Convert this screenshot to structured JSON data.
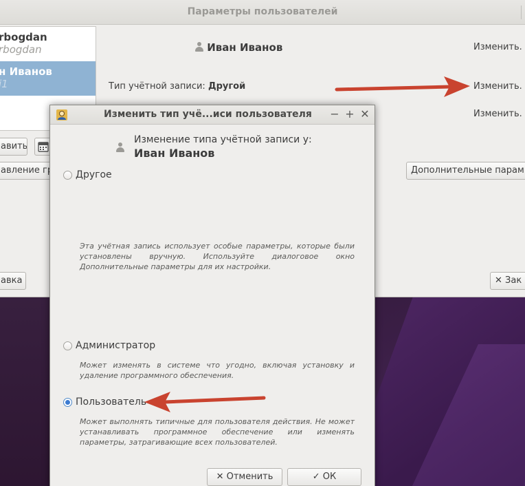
{
  "main_window": {
    "title": "Параметры пользователей",
    "users": [
      {
        "name": "rbogdan",
        "sub": "rbogdan"
      },
      {
        "name": "н Иванов",
        "sub": "i1"
      }
    ],
    "full_name": "Иван Иванов",
    "account_type_label": "Тип учётной записи:",
    "account_type_value": "Другой",
    "change_links": [
      "Изменить.",
      "Изменить.",
      "Изменить."
    ],
    "add_button": "авить",
    "manage_groups_button": "авление гр",
    "additional_params_button": "Дополнительные парам",
    "help_button": "авка",
    "close_button": "Зак"
  },
  "dialog": {
    "title": "Изменить тип учё...иси пользователя",
    "heading": "Изменение типа учётной записи у:",
    "user_name": "Иван Иванов",
    "options": [
      {
        "label": "Другое",
        "description": "Эта учётная запись использует особые параметры, которые были установлены вручную. Используйте диалоговое окно Дополнительные параметры для их настройки.",
        "selected": false
      },
      {
        "label": "Администратор",
        "description": "Может изменять в системе что угодно, включая установку и удаление программного обеспечения.",
        "selected": false
      },
      {
        "label": "Пользователь",
        "description": "Может выполнять типичные для пользователя действия. Не может устанавливать программное обеспечение или изменять параметры, затрагивающие всех пользователей.",
        "selected": true
      }
    ],
    "cancel_button": "Отменить",
    "ok_button": "ОК"
  },
  "colors": {
    "arrow": "#c9432f",
    "selection": "#8fb3d3",
    "radio_accent": "#3b7bd1"
  }
}
